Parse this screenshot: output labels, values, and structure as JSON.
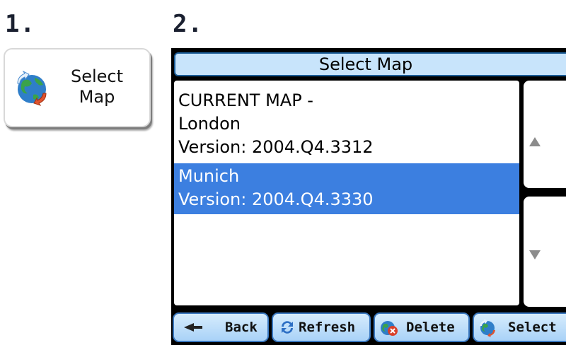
{
  "steps": {
    "one": "1.",
    "two": "2."
  },
  "select_map_button": {
    "line1": "Select",
    "line2": "Map",
    "icon": "globe-refresh-icon"
  },
  "dialog": {
    "title": "Select Map",
    "maps": [
      {
        "header": "CURRENT MAP -",
        "name": "London",
        "version": "Version:  2004.Q4.3312",
        "selected": false
      },
      {
        "name": "Munich",
        "version": "Version:  2004.Q4.3330",
        "selected": true
      }
    ],
    "scroll_up_icon": "triangle-up-icon",
    "scroll_down_icon": "triangle-down-icon"
  },
  "toolbar": {
    "back": "Back",
    "refresh": "Refresh",
    "delete": "Delete",
    "select": "Select"
  },
  "colors": {
    "selection": "#3c7fe0",
    "titlebar": "#c8e4fb",
    "toolbar_button": "#bfe0fa"
  }
}
